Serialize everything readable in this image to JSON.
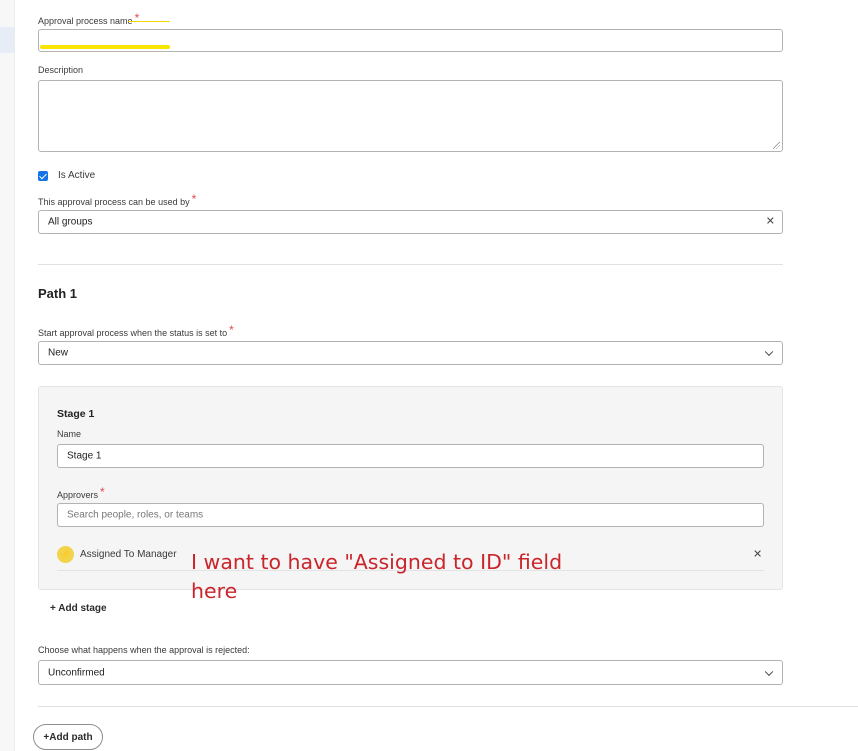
{
  "form": {
    "approval_name_label": "Approval process name",
    "approval_name_value": "",
    "description_label": "Description",
    "description_value": "",
    "is_active_label": "Is Active",
    "is_active_checked": true,
    "used_by_label": "This approval process can be used by",
    "used_by_value": "All groups",
    "required_mark": "*"
  },
  "path": {
    "title": "Path 1",
    "start_status_label": "Start approval process when the status is set to",
    "start_status_value": "New",
    "stage": {
      "title": "Stage 1",
      "name_label": "Name",
      "name_value": "Stage 1",
      "approvers_label": "Approvers",
      "approvers_placeholder": "Search people, roles, or teams",
      "approver_item": "Assigned To Manager",
      "approver_icon": "bolt-icon"
    },
    "add_stage_label": "+ Add stage",
    "rejected_label": "Choose what happens when the approval is rejected:",
    "rejected_value": "Unconfirmed"
  },
  "add_path_label": "+Add path",
  "annotation": {
    "line1": "I want to have \"Assigned to ID\" field",
    "line2": "here",
    "color": "#c9252b"
  },
  "colors": {
    "accent": "#1473e6",
    "required": "#e34850",
    "highlight": "#f7e400"
  }
}
